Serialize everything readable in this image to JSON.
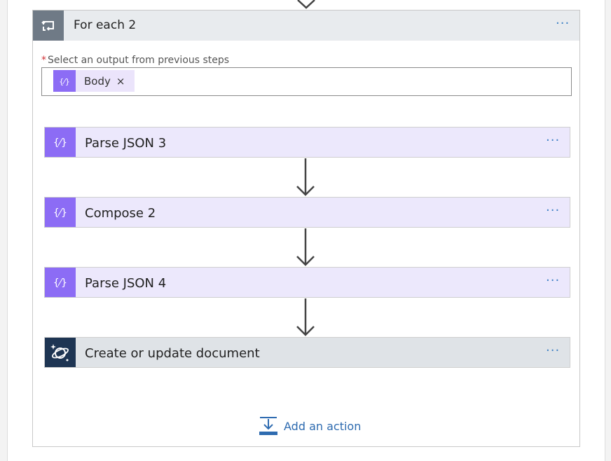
{
  "loop": {
    "title": "For each 2",
    "more_label": "···"
  },
  "select_output": {
    "required_mark": "*",
    "label": "Select an output from previous steps",
    "token": {
      "label": "Body",
      "remove": "×",
      "icon": "data-operation-icon"
    }
  },
  "actions": [
    {
      "title": "Parse JSON 3",
      "icon": "data-operation-icon",
      "more": "···"
    },
    {
      "title": "Compose 2",
      "icon": "data-operation-icon",
      "more": "···"
    },
    {
      "title": "Parse JSON 4",
      "icon": "data-operation-icon",
      "more": "···"
    },
    {
      "title": "Create or update document",
      "icon": "cosmos-db-icon",
      "more": "···"
    }
  ],
  "add_action": {
    "label": "Add an action",
    "icon": "add-action-icon"
  },
  "colors": {
    "data_operation": "#8c6cf5",
    "data_operation_bg": "#ece8fc",
    "cosmos": "#1e3553",
    "loop_icon": "#6f7a86",
    "link": "#2e6bb0"
  }
}
